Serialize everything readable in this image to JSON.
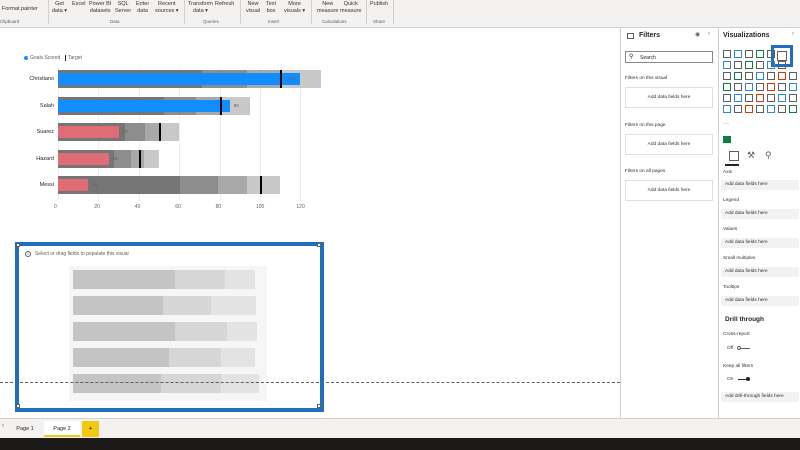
{
  "ribbon": {
    "items": [
      {
        "label": "Format painter"
      },
      {
        "label": "Get\ndata ▾"
      },
      {
        "label": "Excel"
      },
      {
        "label": "Power BI\ndatasets"
      },
      {
        "label": "SQL\nServer"
      },
      {
        "label": "Enter\ndata"
      },
      {
        "label": "Recent\nsources ▾"
      },
      {
        "label": "Transform\ndata ▾"
      },
      {
        "label": "Refresh"
      },
      {
        "label": "New\nvisual"
      },
      {
        "label": "Text\nbox"
      },
      {
        "label": "More\nvisuals ▾"
      },
      {
        "label": "New\nmeasure"
      },
      {
        "label": "Quick\nmeasure"
      },
      {
        "label": "Publish"
      }
    ],
    "groups": [
      "Clipboard",
      "Data",
      "Queries",
      "Insert",
      "Calculations",
      "Share"
    ]
  },
  "canvas": {
    "legend": {
      "goals_label": "Goals Scored",
      "target_label": "Target"
    },
    "placeholder_text": "Select or drag fields to populate this visual"
  },
  "chart_data": {
    "type": "bar",
    "subtype": "bullet",
    "categories": [
      "Christiano",
      "Salah",
      "Suarez",
      "Hazard",
      "Messi"
    ],
    "series": [
      {
        "name": "Goals Scored",
        "values": [
          120,
          85,
          30,
          25,
          15
        ]
      },
      {
        "name": "Target",
        "values": [
          110,
          80,
          50,
          40,
          100
        ]
      }
    ],
    "x_ticks": [
      "0",
      "20",
      "40",
      "60",
      "80",
      "100",
      "120"
    ],
    "xlim": [
      0,
      120
    ],
    "data_labels": [
      "120",
      "85",
      "30",
      "25",
      "15"
    ],
    "bar_colors": [
      "#118dff",
      "#118dff",
      "#e06c75",
      "#e06c75",
      "#e06c75"
    ],
    "legend_position": "top-left"
  },
  "filters": {
    "title": "Filters",
    "search_placeholder": "Search",
    "sections": [
      {
        "label": "Filters on this visual",
        "drop": "Add data fields here"
      },
      {
        "label": "Filters on this page",
        "drop": "Add data fields here"
      },
      {
        "label": "Filters on all pages",
        "drop": "Add data fields here"
      }
    ]
  },
  "visualizations": {
    "title": "Visualizations",
    "wells": [
      {
        "label": "Axis",
        "drop": "Add data fields here"
      },
      {
        "label": "Legend",
        "drop": "Add data fields here"
      },
      {
        "label": "Values",
        "drop": "Add data fields here"
      },
      {
        "label": "Small multiples",
        "drop": "Add data fields here"
      },
      {
        "label": "Tooltips",
        "drop": "Add data fields here"
      }
    ],
    "drill_title": "Drill through",
    "cross_report_label": "Cross-report",
    "cross_report_state": "Off",
    "keep_filters_label": "Keep all filters",
    "keep_filters_state": "On",
    "drill_drop": "Add drill-through fields here"
  },
  "pages": {
    "tabs": [
      {
        "label": "Page 1"
      },
      {
        "label": "Page 2"
      }
    ],
    "add_label": "+"
  },
  "colors": {
    "accent": "#1f6fbf",
    "tab_active": "#f2c811"
  }
}
